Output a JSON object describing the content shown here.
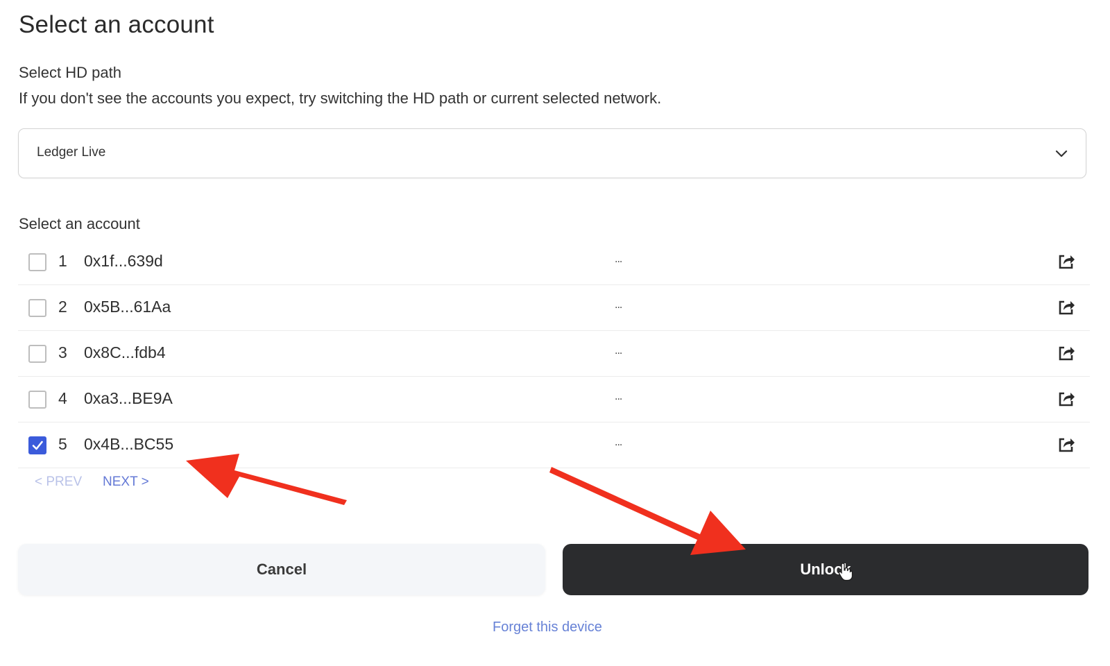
{
  "title": "Select an account",
  "hd_path": {
    "label": "Select HD path",
    "help": "If you don't see the accounts you expect, try switching the HD path or current selected network.",
    "selected": "Ledger Live"
  },
  "accounts_section": {
    "label": "Select an account",
    "rows": [
      {
        "index": "1",
        "address": "0x1f...639d",
        "balance": "...",
        "checked": false
      },
      {
        "index": "2",
        "address": "0x5B...61Aa",
        "balance": "...",
        "checked": false
      },
      {
        "index": "3",
        "address": "0x8C...fdb4",
        "balance": "...",
        "checked": false
      },
      {
        "index": "4",
        "address": "0xa3...BE9A",
        "balance": "...",
        "checked": false
      },
      {
        "index": "5",
        "address": "0x4B...BC55",
        "balance": "...",
        "checked": true
      }
    ]
  },
  "pagination": {
    "prev": "< PREV",
    "next": "NEXT >"
  },
  "buttons": {
    "cancel": "Cancel",
    "unlock": "Unlock"
  },
  "forget_link": "Forget this device",
  "colors": {
    "checkbox_checked": "#3b5bdb",
    "unlock_bg": "#2b2c2e",
    "link": "#6782d6",
    "annotation_arrow": "#f0301e"
  },
  "icons": {
    "dropdown": "chevron-down-icon",
    "external": "external-link-icon",
    "check": "check-icon",
    "cursor": "hand-cursor-icon"
  }
}
